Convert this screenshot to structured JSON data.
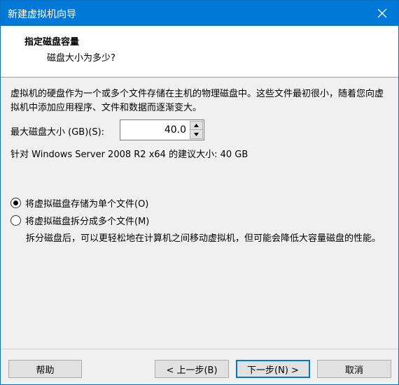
{
  "window": {
    "title": "新建虚拟机向导"
  },
  "header": {
    "title": "指定磁盘容量",
    "subtitle": "磁盘大小为多少?"
  },
  "description": "虚拟机的硬盘作为一个或多个文件存储在主机的物理磁盘中。这些文件最初很小，随着您向虚拟机中添加应用程序、文件和数据而逐渐变大。",
  "disk_size": {
    "label": "最大磁盘大小 (GB)(S):",
    "value": "40.0"
  },
  "recommendation": "针对 Windows Server 2008 R2 x64 的建议大小: 40 GB",
  "options": {
    "single_file": {
      "label": "将虚拟磁盘存储为单个文件(O)",
      "selected": true
    },
    "split_files": {
      "label": "将虚拟磁盘拆分成多个文件(M)",
      "selected": false
    },
    "split_description": "拆分磁盘后，可以更轻松地在计算机之间移动虚拟机，但可能会降低大容量磁盘的性能。"
  },
  "buttons": {
    "help": "帮助",
    "back": "< 上一步(B)",
    "next": "下一步(N) >",
    "cancel": "取消"
  },
  "colors": {
    "titlebar": "#0078d7",
    "primary_border": "#0078d7"
  },
  "icons": {
    "close": "close-icon",
    "spin_up": "spin-up-arrow-icon",
    "spin_down": "spin-down-arrow-icon"
  }
}
